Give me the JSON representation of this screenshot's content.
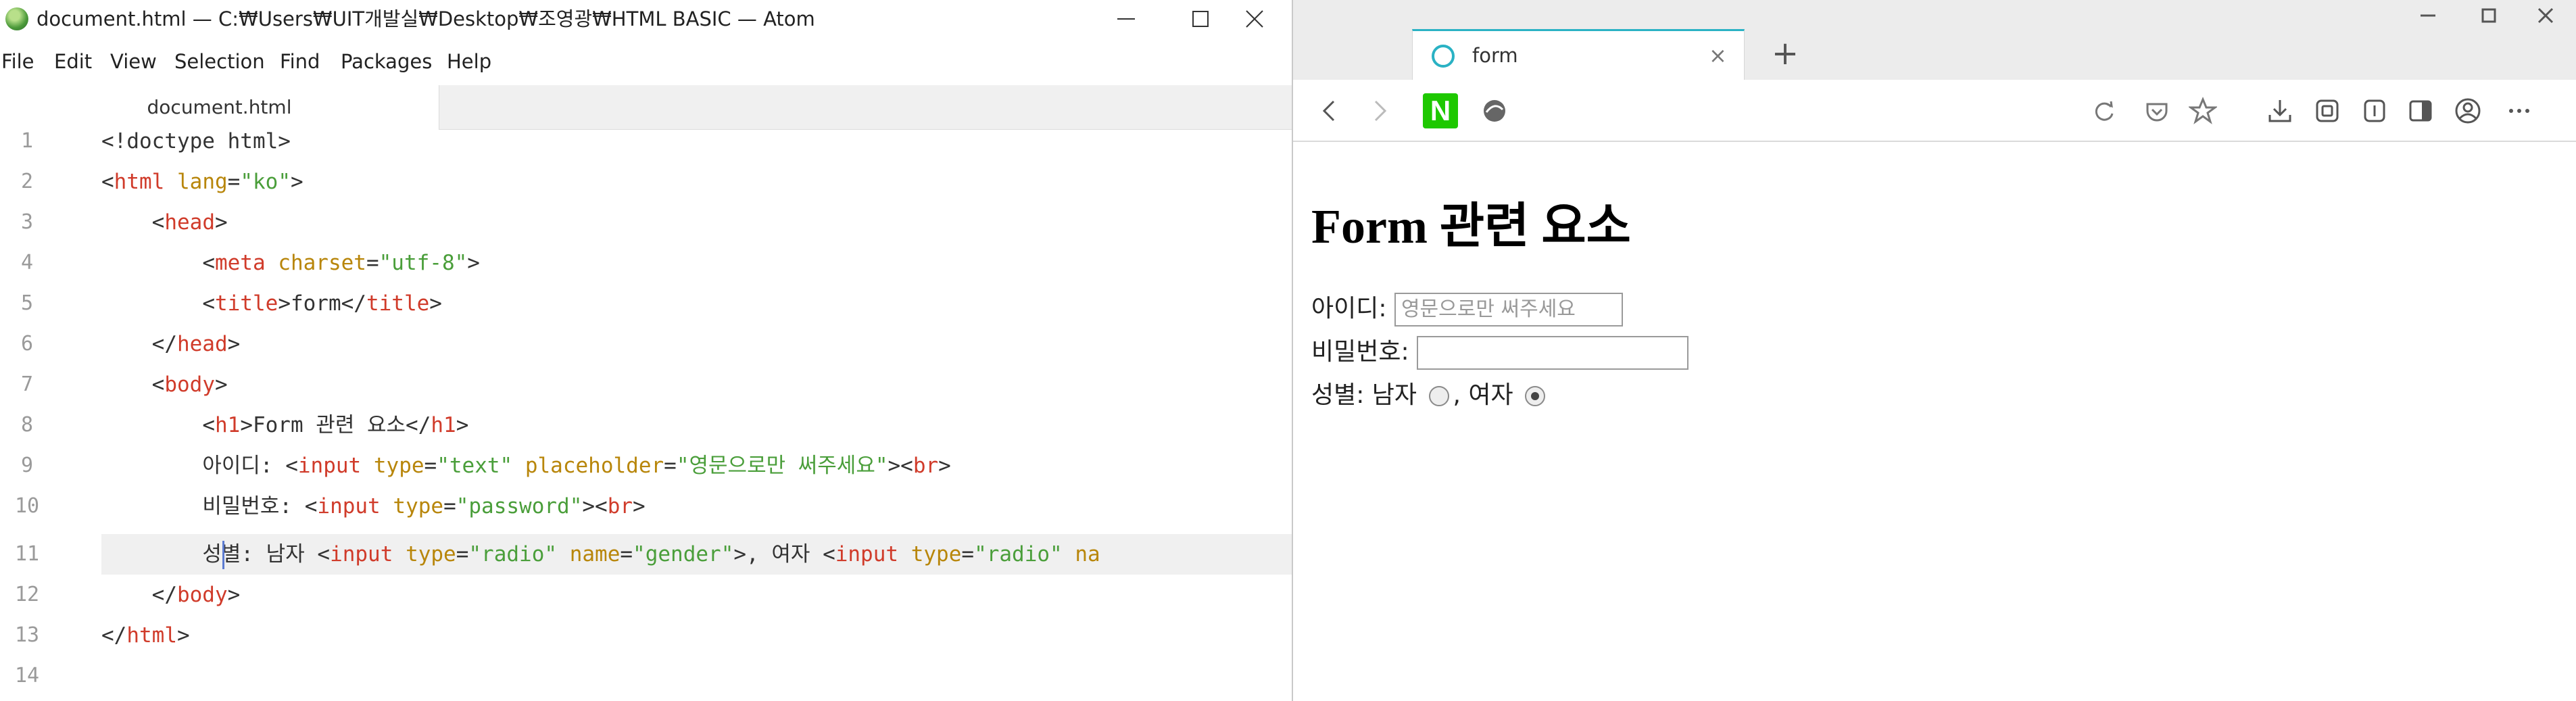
{
  "atom": {
    "title": "document.html — C:₩Users₩UIT개발실₩Desktop₩조영광₩HTML BASIC — Atom",
    "menu": [
      "File",
      "Edit",
      "View",
      "Selection",
      "Find",
      "Packages",
      "Help"
    ],
    "tab_label": "document.html",
    "line_numbers": [
      "1",
      "2",
      "3",
      "4",
      "5",
      "6",
      "7",
      "8",
      "9",
      "10",
      "11",
      "12",
      "13",
      "14"
    ],
    "code": {
      "l1_text": "<!doctype html>",
      "l2_open": "<",
      "l2_tag": "html",
      "l2_attr": "lang",
      "l2_eq": "=",
      "l2_val": "\"ko\"",
      "l2_close": ">",
      "l3_open": "<",
      "l3_tag": "head",
      "l3_close": ">",
      "l4_open": "<",
      "l4_tag": "meta",
      "l4_attr": "charset",
      "l4_eq": "=",
      "l4_val": "\"utf-8\"",
      "l4_close": ">",
      "l5_open": "<",
      "l5_tag": "title",
      "l5_close": ">",
      "l5_text": "form",
      "l5_end_open": "</",
      "l5_end_tag": "title",
      "l5_end_close": ">",
      "l6_open": "</",
      "l6_tag": "head",
      "l6_close": ">",
      "l7_open": "<",
      "l7_tag": "body",
      "l7_close": ">",
      "l8_open": "<",
      "l8_tag": "h1",
      "l8_close": ">",
      "l8_text": "Form 관련 요소",
      "l8_end_open": "</",
      "l8_end_tag": "h1",
      "l8_end_close": ">",
      "l9_text": "아이디: ",
      "l9_open": "<",
      "l9_tag": "input",
      "l9_attr1": "type",
      "l9_eq1": "=",
      "l9_val1": "\"text\"",
      "l9_attr2": "placeholder",
      "l9_eq2": "=",
      "l9_val2": "\"영문으로만 써주세요\"",
      "l9_close": "><",
      "l9_br": "br",
      "l9_br_close": ">",
      "l10_text": "비밀번호: ",
      "l10_open": "<",
      "l10_tag": "input",
      "l10_attr": "type",
      "l10_eq": "=",
      "l10_val": "\"password\"",
      "l10_close": "><",
      "l10_br": "br",
      "l10_br_close": ">",
      "l11_text": "성별: 남자 ",
      "l11_open": "<",
      "l11_tag": "input",
      "l11_attr1": "type",
      "l11_eq1": "=",
      "l11_val1": "\"radio\"",
      "l11_attr2": "name",
      "l11_eq2": "=",
      "l11_val2": "\"gender\"",
      "l11_close": ">",
      "l11_text2": ", 여자 ",
      "l11_open2": "<",
      "l11_tag2": "input",
      "l11_attr3": "type",
      "l11_eq3": "=",
      "l11_val3": "\"radio\"",
      "l11_attr4": "na",
      "l12_open": "</",
      "l12_tag": "body",
      "l12_close": ">",
      "l13_open": "</",
      "l13_tag": "html",
      "l13_close": ">"
    }
  },
  "browser": {
    "tab_label": "form",
    "tab_close": "×",
    "new_tab": "+",
    "naver_label": "N",
    "page": {
      "h1": "Form 관련 요소",
      "id_label": "아이디:",
      "id_placeholder": "영문으로만 써주세요",
      "pw_label": "비밀번호:",
      "gender_label": "성별: 남자",
      "gender_sep": ", 여자",
      "male_checked": false,
      "female_checked": true
    }
  },
  "colors": {
    "tag": "#d03b2a",
    "attr": "#b8860b",
    "string": "#4a9e3a",
    "tab_accent": "#2ab2c4",
    "naver_green": "#1ec800"
  }
}
